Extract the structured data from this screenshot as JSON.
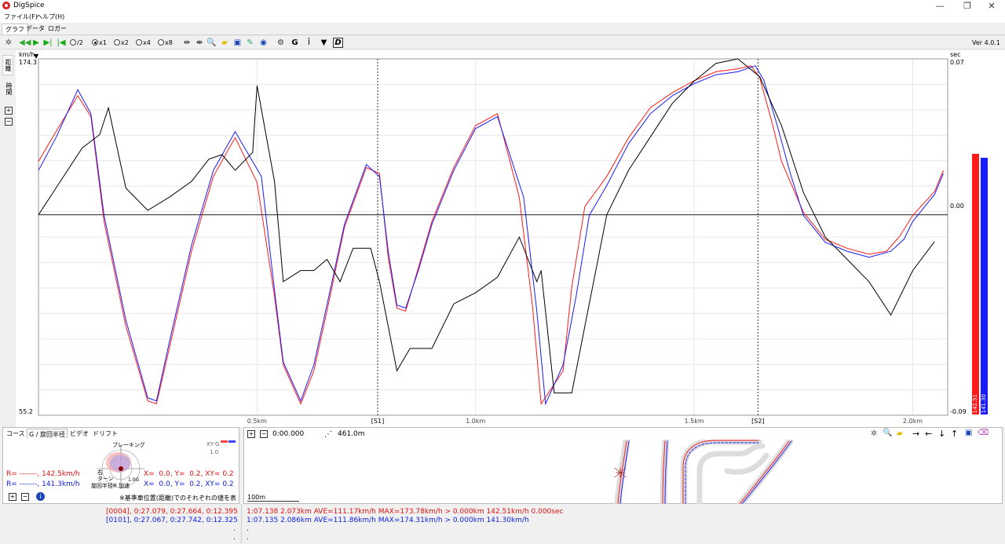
{
  "window": {
    "title": "DigSpice",
    "minimize": "—",
    "restore": "❐",
    "close": "✕"
  },
  "menu": [
    {
      "label": "ファイル(F)"
    },
    {
      "label": "ヘルプ(H)"
    }
  ],
  "tabs": [
    {
      "label": "グラフ"
    },
    {
      "label": "データ"
    },
    {
      "label": "ロガー"
    }
  ],
  "toolbar": {
    "speeds": [
      {
        "label": "/2",
        "selected": false
      },
      {
        "label": "x1",
        "selected": true
      },
      {
        "label": "x2",
        "selected": false
      },
      {
        "label": "x4",
        "selected": false
      },
      {
        "label": "x8",
        "selected": false
      }
    ],
    "icons": [
      "reset-icon",
      "rewind-icon",
      "play-icon",
      "step-forward-icon",
      "step-back-icon"
    ],
    "version": "Ver 4.0.1"
  },
  "sidetabs": [
    {
      "label": "距離"
    },
    {
      "label": "時間"
    }
  ],
  "chart": {
    "left_unit": "km/h",
    "left_max": "174.3",
    "left_min": "55.2",
    "right_unit": "sec",
    "right_max": "0.07",
    "right_zero": "0.00",
    "right_min": "-0.09",
    "x_ticks": [
      "0.5km",
      "1.0km",
      "1.5km",
      "2.0km"
    ],
    "sector_labels": [
      "[S1]",
      "[S2]"
    ],
    "colors": {
      "lap_red": "#ff1a1a",
      "lap_blue": "#1a1aff",
      "delta": "#000000"
    }
  },
  "chart_data": {
    "type": "line",
    "xlabel": "",
    "ylabel": "km/h",
    "xlim": [
      0,
      2.08
    ],
    "ylim": [
      55.2,
      174.3
    ],
    "y2lim": [
      -0.09,
      0.07
    ],
    "x_ticks": [
      0.5,
      1.0,
      1.5,
      2.0
    ],
    "sectors": [
      {
        "name": "[S1]",
        "x": 0.776
      },
      {
        "name": "[S2]",
        "x": 1.646
      }
    ],
    "series": [
      {
        "color": "#ff1a1a",
        "axis": "left",
        "x": [
          0,
          0.04,
          0.09,
          0.12,
          0.15,
          0.2,
          0.25,
          0.27,
          0.3,
          0.35,
          0.4,
          0.45,
          0.5,
          0.54,
          0.56,
          0.6,
          0.63,
          0.66,
          0.7,
          0.75,
          0.78,
          0.8,
          0.82,
          0.84,
          0.87,
          0.9,
          0.95,
          1.0,
          1.05,
          1.1,
          1.13,
          1.15,
          1.2,
          1.22,
          1.25,
          1.3,
          1.35,
          1.4,
          1.45,
          1.5,
          1.55,
          1.6,
          1.63,
          1.65,
          1.68,
          1.7,
          1.75,
          1.8,
          1.85,
          1.9,
          1.94,
          1.97,
          2.0,
          2.05,
          2.07
        ],
        "y": [
          140,
          150,
          162,
          155,
          120,
          85,
          60,
          59,
          78,
          110,
          135,
          148,
          133,
          95,
          72,
          59,
          70,
          90,
          118,
          138,
          136,
          108,
          91,
          90,
          105,
          120,
          138,
          152,
          156,
          128,
          92,
          59,
          70,
          98,
          125,
          135,
          148,
          158,
          163,
          167,
          170,
          171,
          172,
          168,
          152,
          140,
          123,
          114,
          111,
          109,
          110,
          115,
          122,
          130,
          137
        ]
      },
      {
        "color": "#1a1aff",
        "axis": "left",
        "x": [
          0,
          0.04,
          0.09,
          0.12,
          0.15,
          0.2,
          0.25,
          0.27,
          0.3,
          0.35,
          0.4,
          0.45,
          0.51,
          0.54,
          0.56,
          0.6,
          0.63,
          0.66,
          0.7,
          0.75,
          0.78,
          0.8,
          0.82,
          0.84,
          0.87,
          0.9,
          0.95,
          1.0,
          1.05,
          1.11,
          1.14,
          1.16,
          1.2,
          1.23,
          1.26,
          1.3,
          1.35,
          1.4,
          1.45,
          1.5,
          1.55,
          1.6,
          1.64,
          1.66,
          1.69,
          1.72,
          1.75,
          1.8,
          1.85,
          1.9,
          1.95,
          1.98,
          2.0,
          2.05,
          2.07
        ],
        "y": [
          137,
          148,
          164,
          156,
          122,
          87,
          61,
          60,
          80,
          112,
          137,
          150,
          135,
          97,
          73,
          60,
          72,
          92,
          119,
          139,
          135,
          110,
          92,
          91,
          104,
          119,
          137,
          151,
          155,
          128,
          90,
          59,
          72,
          95,
          122,
          132,
          146,
          156,
          162,
          166,
          169,
          170,
          172,
          167,
          152,
          136,
          122,
          113,
          110,
          108,
          110,
          114,
          120,
          129,
          136
        ]
      },
      {
        "color": "#000000",
        "axis": "right",
        "x": [
          0,
          0.05,
          0.1,
          0.14,
          0.16,
          0.2,
          0.25,
          0.3,
          0.35,
          0.39,
          0.42,
          0.45,
          0.49,
          0.5,
          0.54,
          0.56,
          0.6,
          0.63,
          0.66,
          0.69,
          0.72,
          0.76,
          0.78,
          0.8,
          0.82,
          0.85,
          0.9,
          0.95,
          1.0,
          1.05,
          1.1,
          1.14,
          1.15,
          1.18,
          1.22,
          1.25,
          1.3,
          1.35,
          1.4,
          1.45,
          1.5,
          1.55,
          1.6,
          1.65,
          1.7,
          1.75,
          1.8,
          1.85,
          1.9,
          1.95,
          2.0,
          2.05
        ],
        "y": [
          0,
          0.015,
          0.03,
          0.036,
          0.048,
          0.012,
          0.002,
          0.008,
          0.015,
          0.025,
          0.027,
          0.02,
          0.028,
          0.058,
          0.015,
          -0.03,
          -0.025,
          -0.025,
          -0.02,
          -0.03,
          -0.015,
          -0.015,
          -0.03,
          -0.05,
          -0.07,
          -0.06,
          -0.06,
          -0.04,
          -0.035,
          -0.028,
          -0.01,
          -0.03,
          -0.025,
          -0.08,
          -0.08,
          -0.05,
          0,
          0.02,
          0.035,
          0.05,
          0.06,
          0.068,
          0.07,
          0.062,
          0.04,
          0.01,
          -0.01,
          -0.02,
          -0.03,
          -0.045,
          -0.025,
          -0.012
        ]
      }
    ]
  },
  "current_values": {
    "red": "142.51",
    "blue": "141.30"
  },
  "lower_left": {
    "tabs": [
      {
        "label": "コース"
      },
      {
        "label": "G / 旋回半径"
      },
      {
        "label": "ビデオ"
      },
      {
        "label": "ドリフト"
      }
    ],
    "gplot_top": "ブレーキング",
    "gplot_left": "右\nターン",
    "gplot_bottom": "旋回半径R 加速",
    "gplot_scale": "1.0G",
    "xy_label": "XY-G",
    "xy_value": "1.0",
    "row_red_r": "R= -------, 142.5km/h",
    "row_red_xy": "X=  0.0, Y=  0.2, XY= 0.2",
    "row_blue_r": "R= -------, 141.3km/h",
    "row_blue_xy": "X=  0.0, Y=  0.2, XY= 0.2",
    "note": "※基準車位置(距離)でのそれぞれの値を表示"
  },
  "lower_right": {
    "time": "0:00.000",
    "distance": "461.0m",
    "scale": "100m"
  },
  "status": {
    "left_red": "[0004], 0:27.079, 0:27.664, 0:12.395",
    "left_blue": "[0101], 0:27.067, 0:27.742, 0:12.325",
    "right_red": "1:07.138 2.073km AVE=111.17km/h MAX=173.78km/h > 0.000km 142.51km/h 0.000sec",
    "right_blue": "1:07.135 2.086km AVE=111.86km/h MAX=174.31km/h > 0.000km 141.30km/h",
    "dot": "."
  }
}
